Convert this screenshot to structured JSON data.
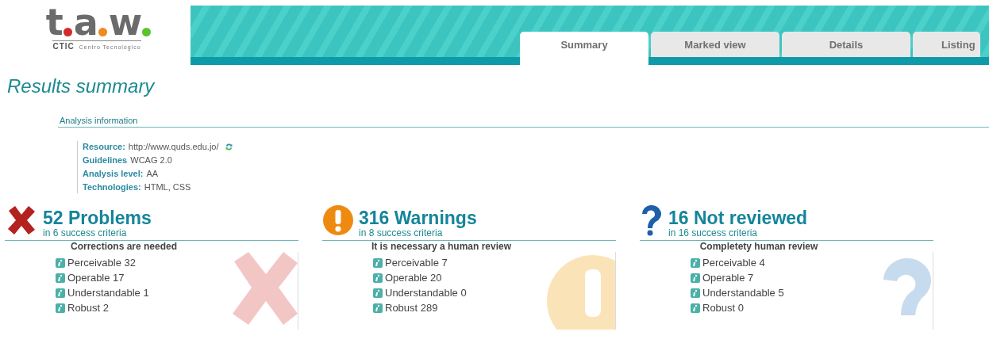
{
  "logo": {
    "letters": [
      {
        "text": "t",
        "color": "#d42a2a"
      },
      {
        "text": "a",
        "color": "#f08a1c"
      },
      {
        "text": "w",
        "color": "#5cc22e"
      }
    ],
    "org": "CTIC",
    "caption": "Centro Tecnológico"
  },
  "tabs": [
    {
      "label": "Summary",
      "selected": true
    },
    {
      "label": "Marked view",
      "selected": false
    },
    {
      "label": "Details",
      "selected": false
    },
    {
      "label": "Listing",
      "selected": false
    }
  ],
  "title": "Results summary",
  "analysis": {
    "heading": "Analysis information",
    "fields": [
      {
        "label": "Resource:",
        "value": "http://www.quds.edu.jo/",
        "refresh": true
      },
      {
        "label": "Guidelines",
        "value": "WCAG 2.0",
        "refresh": false
      },
      {
        "label": "Analysis level:",
        "value": "AA",
        "refresh": false
      },
      {
        "label": "Technologies:",
        "value": "HTML, CSS",
        "refresh": false
      }
    ]
  },
  "panels": [
    {
      "kind": "problem",
      "title": "52 Problems",
      "subtitle": "in 6 success criteria",
      "heading": "Corrections are needed",
      "items": [
        "Perceivable 32",
        "Operable 17",
        "Understandable 1",
        "Robust 2"
      ]
    },
    {
      "kind": "warning",
      "title": "316 Warnings",
      "subtitle": "in 8 success criteria",
      "heading": "It is necessary a human review",
      "items": [
        "Perceivable 7",
        "Operable 20",
        "Understandable 0",
        "Robust 289"
      ]
    },
    {
      "kind": "unreviewed",
      "title": "16 Not reviewed",
      "subtitle": "in 16 success criteria",
      "heading": "Completety human review",
      "items": [
        "Perceivable 4",
        "Operable 7",
        "Understandable 5",
        "Robust 0"
      ]
    }
  ]
}
